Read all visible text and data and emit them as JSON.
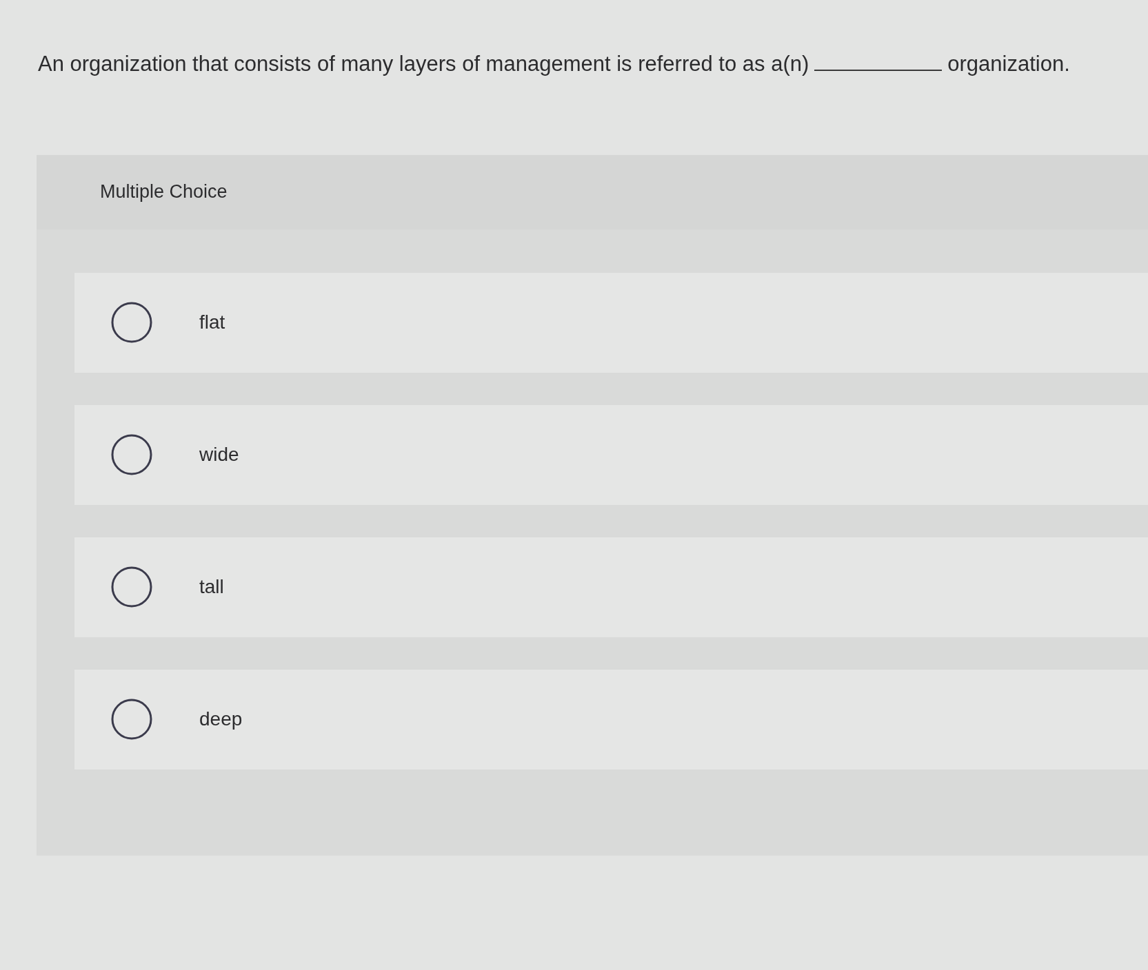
{
  "question": {
    "before": "An organization that consists of many layers of management is referred to as a(n)",
    "after": "organization."
  },
  "panel": {
    "title": "Multiple Choice",
    "options": [
      {
        "label": "flat",
        "selected": false
      },
      {
        "label": "wide",
        "selected": false
      },
      {
        "label": "tall",
        "selected": false
      },
      {
        "label": "deep",
        "selected": false
      }
    ]
  }
}
